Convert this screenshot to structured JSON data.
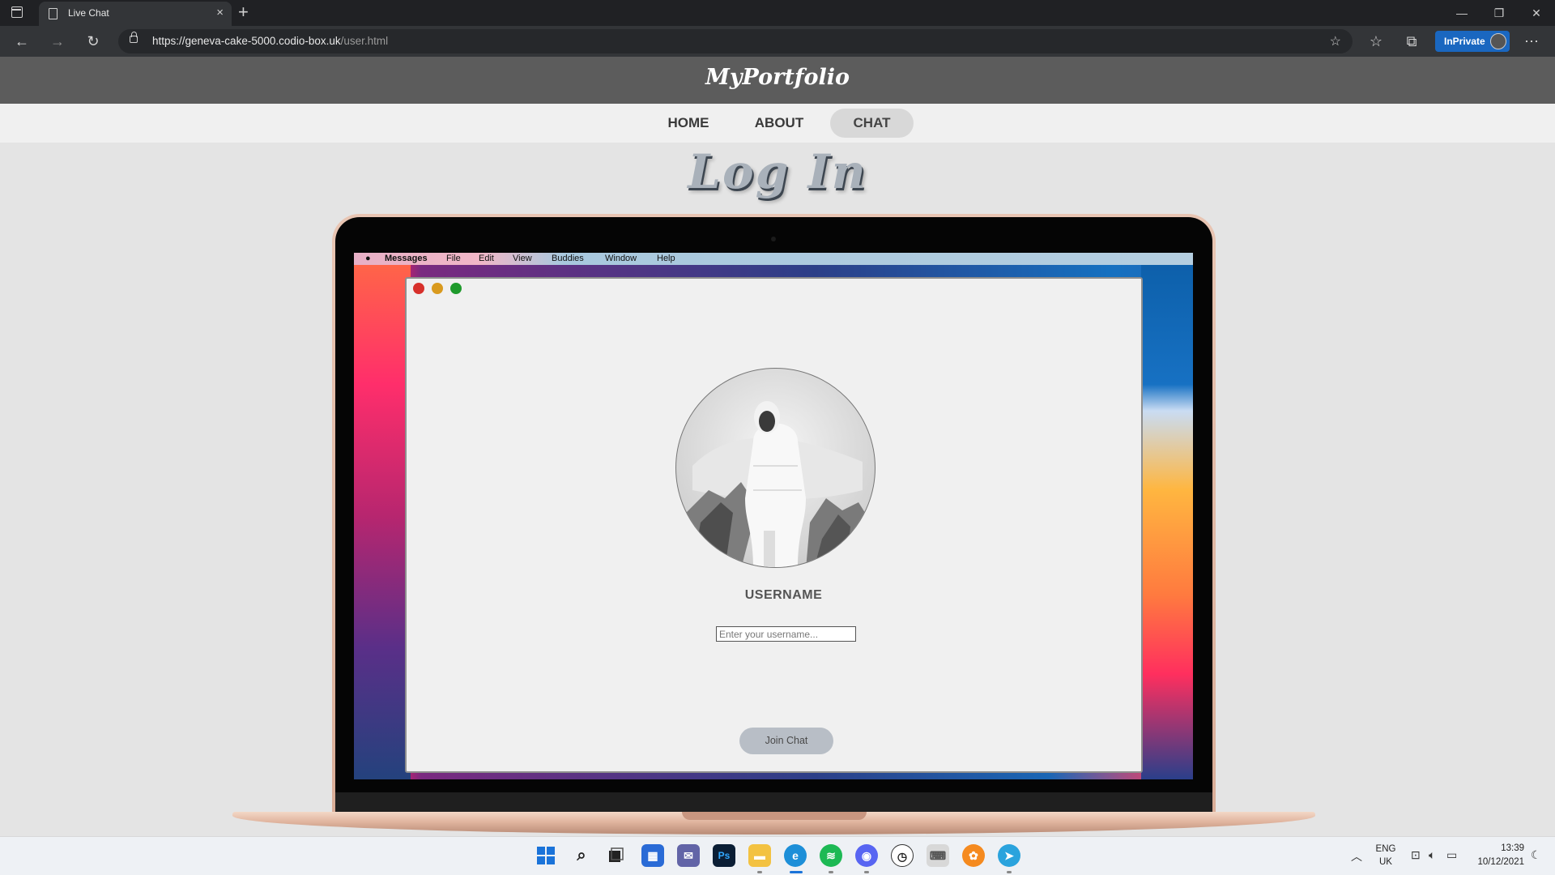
{
  "browser": {
    "tab_title": "Live Chat",
    "new_tab_symbol": "+",
    "close_tab_symbol": "×",
    "url_host": "https://geneva-cake-5000.codio-box.uk",
    "url_path": "/user.html",
    "inprivate_label": "InPrivate",
    "window_controls": [
      "—",
      "❐",
      "✕"
    ]
  },
  "site": {
    "brand": "MyPortfolio",
    "nav": [
      {
        "label": "HOME",
        "active": false
      },
      {
        "label": "ABOUT",
        "active": false
      },
      {
        "label": "CHAT",
        "active": true
      }
    ],
    "page_title": "Log In"
  },
  "mac": {
    "menu": [
      "Messages",
      "File",
      "Edit",
      "View",
      "Buddies",
      "Window",
      "Help"
    ],
    "traffic_lights": [
      "#d7302b",
      "#d99a1e",
      "#1f9a2c"
    ]
  },
  "login": {
    "username_label": "USERNAME",
    "username_value": "",
    "username_placeholder": "Enter your username...",
    "join_button": "Join Chat"
  },
  "taskbar": {
    "language_line1": "ENG",
    "language_line2": "UK",
    "time": "13:39",
    "date": "10/12/2021",
    "apps": [
      "start-icon",
      "search-icon",
      "task-view-icon",
      "widgets-icon",
      "teams-chat-icon",
      "photoshop-icon",
      "file-explorer-icon",
      "edge-icon",
      "spotify-icon",
      "discord-icon",
      "clock-icon",
      "keyboard-icon",
      "fl-studio-icon",
      "telegram-icon"
    ]
  },
  "colors": {
    "header_bg": "#5c5c5c",
    "accent_blue": "#1a67c0",
    "join_button_bg": "#b8bec6"
  }
}
